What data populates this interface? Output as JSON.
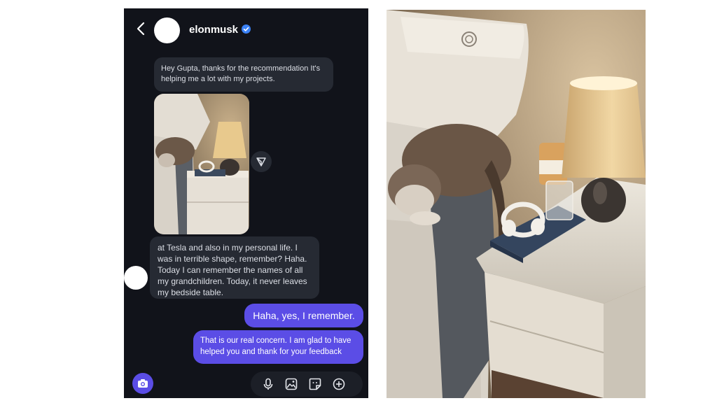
{
  "header": {
    "username": "elonmusk",
    "icons": {
      "back": "chevron-left-icon",
      "verified": "verified-badge-icon"
    }
  },
  "messages": {
    "incoming_1": "Hey Gupta, thanks for the recommendation It's helping me a lot with my projects.",
    "incoming_2": "at Tesla and also in my personal life. I was in terrible shape, remember? Haha. Today I can remember the names of all my grandchildren. Today, it never leaves my bedside table.",
    "outgoing_1": "Haha, yes, I remember.",
    "outgoing_2": "That is our real concern. I am glad to have helped you and thank for your feedback"
  },
  "attachment": {
    "image": "photo-cat-on-bed-beside-nightstand-with-lamp"
  },
  "composer": {
    "icons": [
      "camera-icon",
      "microphone-icon",
      "gallery-icon",
      "sticker-icon",
      "plus-circle-icon"
    ]
  },
  "colors": {
    "background": "#11131a",
    "incoming_bubble": "#262a33",
    "outgoing_bubble": "#5b4de6",
    "verified": "#3b82f6"
  }
}
